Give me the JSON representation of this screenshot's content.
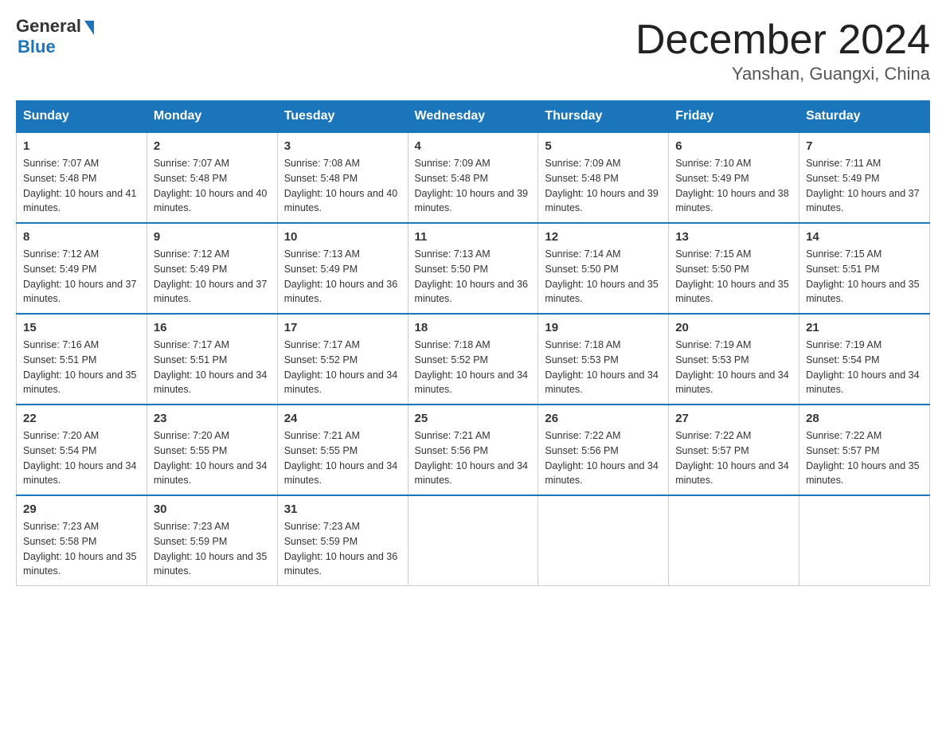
{
  "header": {
    "logo_general": "General",
    "logo_blue": "Blue",
    "month_title": "December 2024",
    "location": "Yanshan, Guangxi, China"
  },
  "days_of_week": [
    "Sunday",
    "Monday",
    "Tuesday",
    "Wednesday",
    "Thursday",
    "Friday",
    "Saturday"
  ],
  "weeks": [
    [
      {
        "day": "1",
        "sunrise": "7:07 AM",
        "sunset": "5:48 PM",
        "daylight": "10 hours and 41 minutes."
      },
      {
        "day": "2",
        "sunrise": "7:07 AM",
        "sunset": "5:48 PM",
        "daylight": "10 hours and 40 minutes."
      },
      {
        "day": "3",
        "sunrise": "7:08 AM",
        "sunset": "5:48 PM",
        "daylight": "10 hours and 40 minutes."
      },
      {
        "day": "4",
        "sunrise": "7:09 AM",
        "sunset": "5:48 PM",
        "daylight": "10 hours and 39 minutes."
      },
      {
        "day": "5",
        "sunrise": "7:09 AM",
        "sunset": "5:48 PM",
        "daylight": "10 hours and 39 minutes."
      },
      {
        "day": "6",
        "sunrise": "7:10 AM",
        "sunset": "5:49 PM",
        "daylight": "10 hours and 38 minutes."
      },
      {
        "day": "7",
        "sunrise": "7:11 AM",
        "sunset": "5:49 PM",
        "daylight": "10 hours and 37 minutes."
      }
    ],
    [
      {
        "day": "8",
        "sunrise": "7:12 AM",
        "sunset": "5:49 PM",
        "daylight": "10 hours and 37 minutes."
      },
      {
        "day": "9",
        "sunrise": "7:12 AM",
        "sunset": "5:49 PM",
        "daylight": "10 hours and 37 minutes."
      },
      {
        "day": "10",
        "sunrise": "7:13 AM",
        "sunset": "5:49 PM",
        "daylight": "10 hours and 36 minutes."
      },
      {
        "day": "11",
        "sunrise": "7:13 AM",
        "sunset": "5:50 PM",
        "daylight": "10 hours and 36 minutes."
      },
      {
        "day": "12",
        "sunrise": "7:14 AM",
        "sunset": "5:50 PM",
        "daylight": "10 hours and 35 minutes."
      },
      {
        "day": "13",
        "sunrise": "7:15 AM",
        "sunset": "5:50 PM",
        "daylight": "10 hours and 35 minutes."
      },
      {
        "day": "14",
        "sunrise": "7:15 AM",
        "sunset": "5:51 PM",
        "daylight": "10 hours and 35 minutes."
      }
    ],
    [
      {
        "day": "15",
        "sunrise": "7:16 AM",
        "sunset": "5:51 PM",
        "daylight": "10 hours and 35 minutes."
      },
      {
        "day": "16",
        "sunrise": "7:17 AM",
        "sunset": "5:51 PM",
        "daylight": "10 hours and 34 minutes."
      },
      {
        "day": "17",
        "sunrise": "7:17 AM",
        "sunset": "5:52 PM",
        "daylight": "10 hours and 34 minutes."
      },
      {
        "day": "18",
        "sunrise": "7:18 AM",
        "sunset": "5:52 PM",
        "daylight": "10 hours and 34 minutes."
      },
      {
        "day": "19",
        "sunrise": "7:18 AM",
        "sunset": "5:53 PM",
        "daylight": "10 hours and 34 minutes."
      },
      {
        "day": "20",
        "sunrise": "7:19 AM",
        "sunset": "5:53 PM",
        "daylight": "10 hours and 34 minutes."
      },
      {
        "day": "21",
        "sunrise": "7:19 AM",
        "sunset": "5:54 PM",
        "daylight": "10 hours and 34 minutes."
      }
    ],
    [
      {
        "day": "22",
        "sunrise": "7:20 AM",
        "sunset": "5:54 PM",
        "daylight": "10 hours and 34 minutes."
      },
      {
        "day": "23",
        "sunrise": "7:20 AM",
        "sunset": "5:55 PM",
        "daylight": "10 hours and 34 minutes."
      },
      {
        "day": "24",
        "sunrise": "7:21 AM",
        "sunset": "5:55 PM",
        "daylight": "10 hours and 34 minutes."
      },
      {
        "day": "25",
        "sunrise": "7:21 AM",
        "sunset": "5:56 PM",
        "daylight": "10 hours and 34 minutes."
      },
      {
        "day": "26",
        "sunrise": "7:22 AM",
        "sunset": "5:56 PM",
        "daylight": "10 hours and 34 minutes."
      },
      {
        "day": "27",
        "sunrise": "7:22 AM",
        "sunset": "5:57 PM",
        "daylight": "10 hours and 34 minutes."
      },
      {
        "day": "28",
        "sunrise": "7:22 AM",
        "sunset": "5:57 PM",
        "daylight": "10 hours and 35 minutes."
      }
    ],
    [
      {
        "day": "29",
        "sunrise": "7:23 AM",
        "sunset": "5:58 PM",
        "daylight": "10 hours and 35 minutes."
      },
      {
        "day": "30",
        "sunrise": "7:23 AM",
        "sunset": "5:59 PM",
        "daylight": "10 hours and 35 minutes."
      },
      {
        "day": "31",
        "sunrise": "7:23 AM",
        "sunset": "5:59 PM",
        "daylight": "10 hours and 36 minutes."
      },
      null,
      null,
      null,
      null
    ]
  ]
}
